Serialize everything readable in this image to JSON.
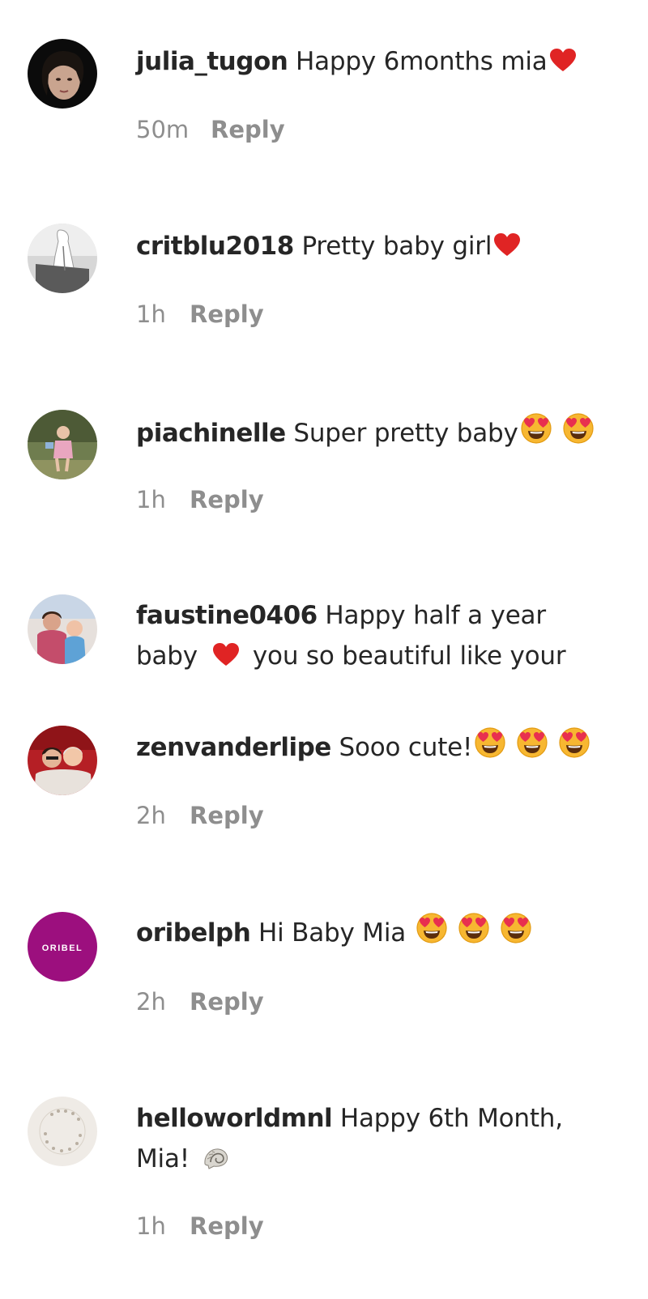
{
  "comments": [
    {
      "username": "julia_tugon",
      "text": "Happy 6months mia",
      "time": "50m",
      "reply": "Reply"
    },
    {
      "username": "critblu2018",
      "text": "Pretty baby girl",
      "time": "1h",
      "reply": "Reply"
    },
    {
      "username": "piachinelle",
      "text": "Super pretty baby",
      "time": "1h",
      "reply": "Reply"
    },
    {
      "username": "faustine0406",
      "text": "Happy half a year",
      "text_line2_a": "baby",
      "text_line2_b": "you so beautiful like your"
    },
    {
      "username": "zenvanderlipe",
      "text": "Sooo cute!",
      "time": "2h",
      "reply": "Reply"
    },
    {
      "username": "oribelph",
      "text": "Hi Baby Mia",
      "time": "2h",
      "reply": "Reply",
      "avatar_text": "ORIBEL"
    },
    {
      "username": "helloworldmnl",
      "text": "Happy 6th Month,",
      "text_line2": "Mia!",
      "time": "1h",
      "reply": "Reply"
    }
  ],
  "icons": {
    "heart": "red-heart-icon",
    "heart_eyes": "smiling-face-with-heart-eyes-icon",
    "shell": "spiral-shell-icon"
  },
  "colors": {
    "heart": "#e02424",
    "emoji_face": "#f7b731",
    "emoji_heart": "#e8304f",
    "secondary_text": "#8e8e8e",
    "oribel_brand": "#9c0f7e"
  }
}
